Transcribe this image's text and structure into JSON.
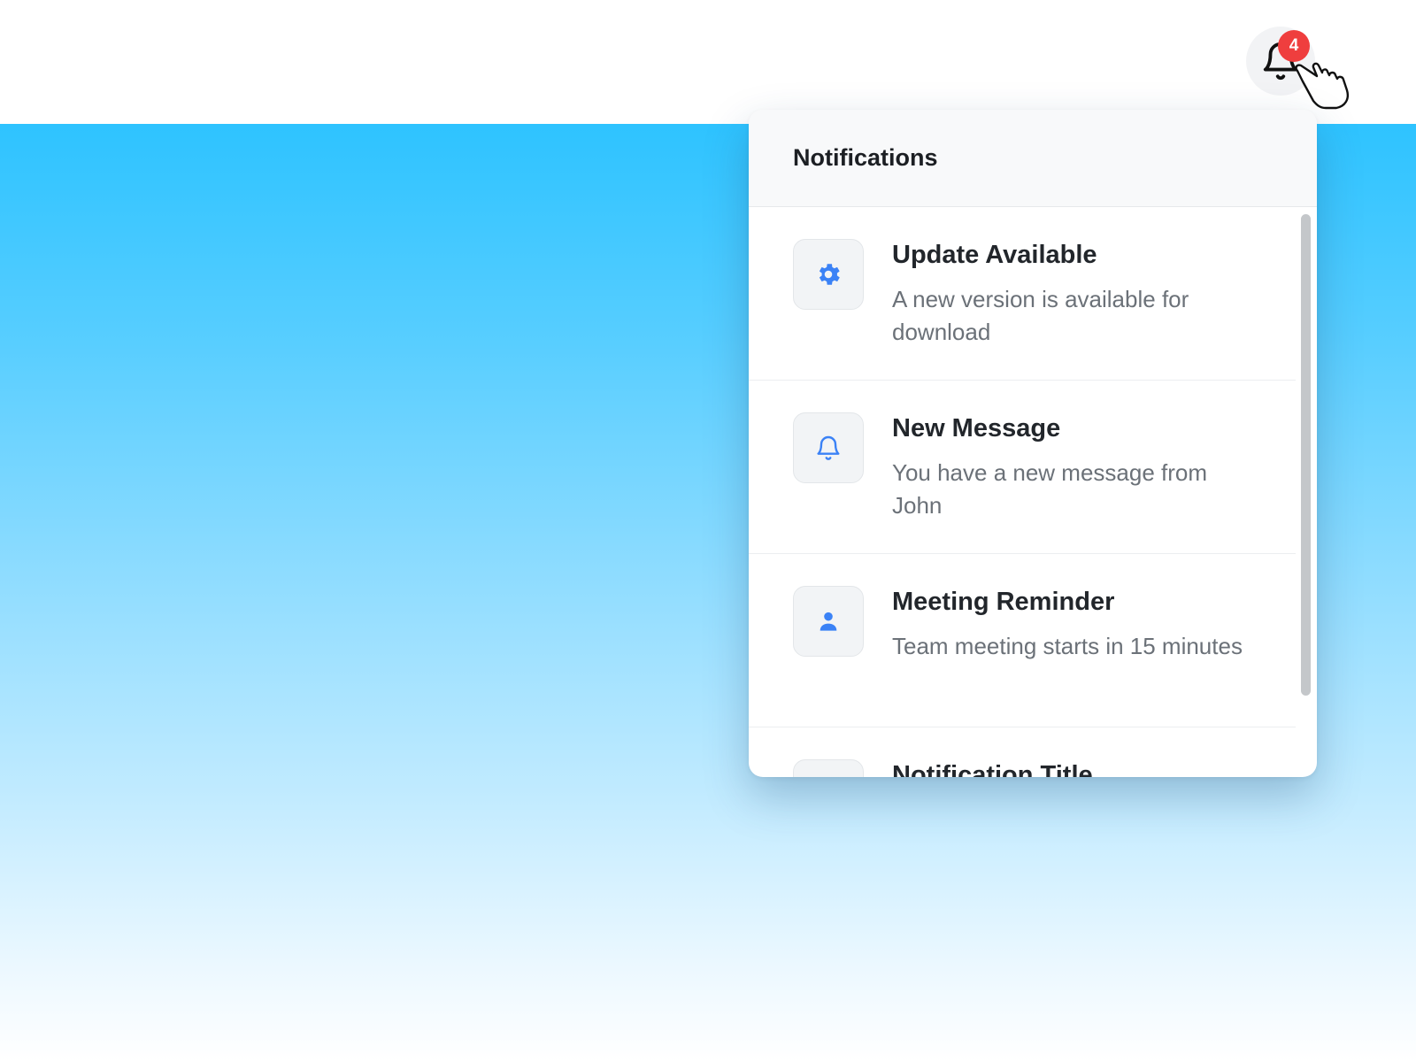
{
  "notifications_button": {
    "badge_count": "4"
  },
  "panel": {
    "title": "Notifications",
    "items": [
      {
        "icon": "gear-icon",
        "title": "Update Available",
        "body": "A new version is available for download"
      },
      {
        "icon": "bell-icon",
        "title": "New Message",
        "body": "You have a new message from John"
      },
      {
        "icon": "user-icon",
        "title": "Meeting Reminder",
        "body": "Team meeting starts in 15 minutes"
      },
      {
        "icon": "generic-icon",
        "title": "Notification Title",
        "body": ""
      }
    ]
  },
  "colors": {
    "accent": "#3b82f6",
    "badge": "#ef3e3e",
    "hero_top": "#2ec3ff",
    "hero_bottom": "#ffffff"
  }
}
